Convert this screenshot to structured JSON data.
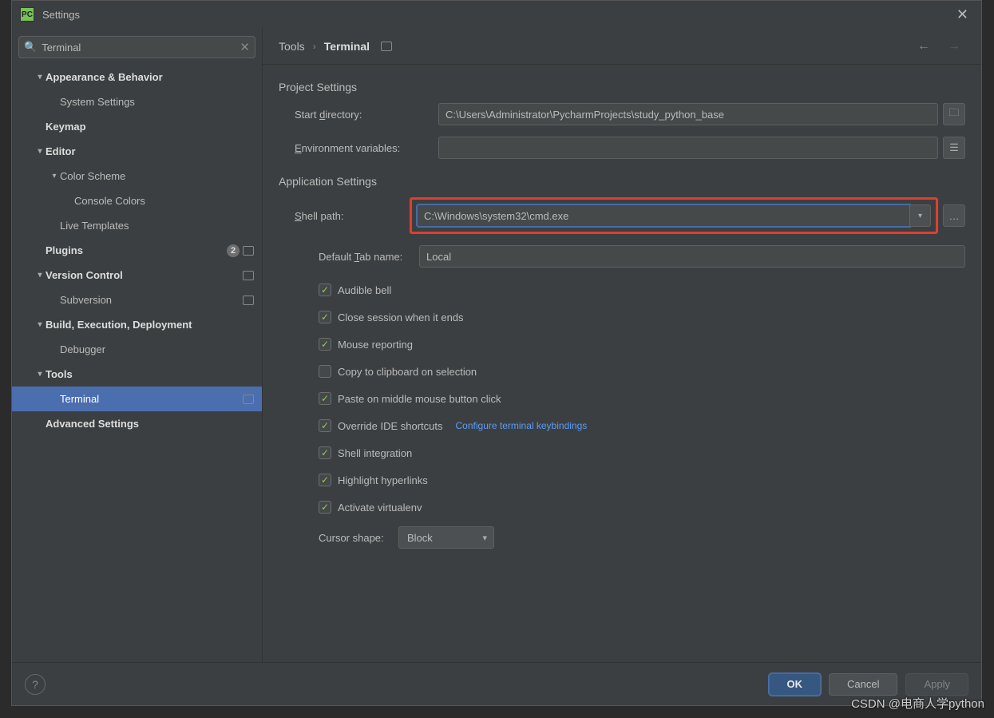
{
  "window": {
    "title": "Settings"
  },
  "search": {
    "value": "Terminal"
  },
  "tree": [
    {
      "label": "Appearance & Behavior",
      "indent": 1,
      "bold": true,
      "arrow": "down"
    },
    {
      "label": "System Settings",
      "indent": 2
    },
    {
      "label": "Keymap",
      "indent": 1,
      "bold": true
    },
    {
      "label": "Editor",
      "indent": 1,
      "bold": true,
      "arrow": "down"
    },
    {
      "label": "Color Scheme",
      "indent": 2,
      "arrow": "down"
    },
    {
      "label": "Console Colors",
      "indent": 3
    },
    {
      "label": "Live Templates",
      "indent": 2
    },
    {
      "label": "Plugins",
      "indent": 1,
      "bold": true,
      "badge": "2",
      "proj": true
    },
    {
      "label": "Version Control",
      "indent": 1,
      "bold": true,
      "arrow": "down",
      "proj": true
    },
    {
      "label": "Subversion",
      "indent": 2,
      "proj": true
    },
    {
      "label": "Build, Execution, Deployment",
      "indent": 1,
      "bold": true,
      "arrow": "down"
    },
    {
      "label": "Debugger",
      "indent": 2
    },
    {
      "label": "Tools",
      "indent": 1,
      "bold": true,
      "arrow": "down"
    },
    {
      "label": "Terminal",
      "indent": 2,
      "selected": true,
      "proj": true
    },
    {
      "label": "Advanced Settings",
      "indent": 1,
      "bold": true
    }
  ],
  "breadcrumb": {
    "root": "Tools",
    "leaf": "Terminal"
  },
  "sections": {
    "project": {
      "title": "Project Settings",
      "start_dir_label": "Start directory:",
      "start_dir_value": "C:\\Users\\Administrator\\PycharmProjects\\study_python_base",
      "env_label": "Environment variables:",
      "env_value": ""
    },
    "app": {
      "title": "Application Settings",
      "shell_label": "Shell path:",
      "shell_value": "C:\\Windows\\system32\\cmd.exe",
      "tab_label": "Default Tab name:",
      "tab_value": "Local",
      "checks": [
        {
          "label": "Audible bell",
          "checked": true
        },
        {
          "label": "Close session when it ends",
          "checked": true
        },
        {
          "label": "Mouse reporting",
          "checked": true
        },
        {
          "label": "Copy to clipboard on selection",
          "checked": false
        },
        {
          "label": "Paste on middle mouse button click",
          "checked": true
        },
        {
          "label": "Override IDE shortcuts",
          "checked": true,
          "link": "Configure terminal keybindings"
        },
        {
          "label": "Shell integration",
          "checked": true
        },
        {
          "label": "Highlight hyperlinks",
          "checked": true
        },
        {
          "label": "Activate virtualenv",
          "checked": true
        }
      ],
      "cursor_label": "Cursor shape:",
      "cursor_value": "Block"
    }
  },
  "footer": {
    "ok": "OK",
    "cancel": "Cancel",
    "apply": "Apply"
  },
  "watermark": "CSDN @电商人学python"
}
